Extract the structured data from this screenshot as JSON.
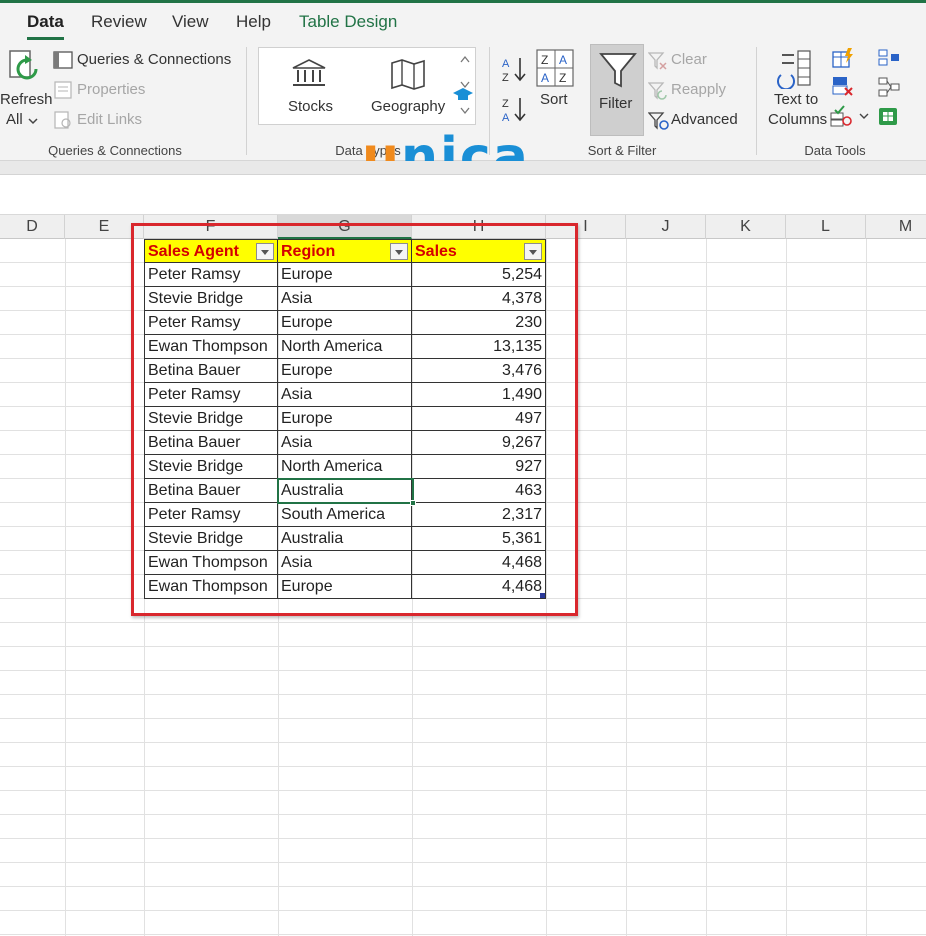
{
  "tabs": [
    {
      "label": "Data",
      "active": true
    },
    {
      "label": "Review"
    },
    {
      "label": "View"
    },
    {
      "label": "Help"
    },
    {
      "label": "Table Design"
    }
  ],
  "ribbon": {
    "queries": {
      "refresh_label_1": "Refresh",
      "refresh_label_2": "All",
      "queries_connections": "Queries & Connections",
      "properties": "Properties",
      "edit_links": "Edit Links",
      "group_label": "Queries & Connections"
    },
    "data_types": {
      "stocks": "Stocks",
      "geography": "Geography",
      "group_label": "Data Types"
    },
    "sort_filter": {
      "sort": "Sort",
      "filter": "Filter",
      "clear": "Clear",
      "reapply": "Reapply",
      "advanced": "Advanced",
      "group_label": "Sort & Filter"
    },
    "data_tools": {
      "text_to_columns_1": "Text to",
      "text_to_columns_2": "Columns",
      "group_label": "Data Tools"
    }
  },
  "watermark": {
    "first": "u",
    "rest": "nica"
  },
  "columns": [
    "D",
    "E",
    "F",
    "G",
    "H",
    "I",
    "J",
    "K",
    "L",
    "M"
  ],
  "table": {
    "headers": [
      "Sales Agent",
      "Region",
      "Sales"
    ],
    "rows": [
      [
        "Peter Ramsy",
        "Europe",
        "5,254"
      ],
      [
        "Stevie Bridge",
        "Asia",
        "4,378"
      ],
      [
        "Peter Ramsy",
        "Europe",
        "230"
      ],
      [
        "Ewan Thompson",
        "North America",
        "13,135"
      ],
      [
        "Betina Bauer",
        "Europe",
        "3,476"
      ],
      [
        "Peter Ramsy",
        "Asia",
        "1,490"
      ],
      [
        "Stevie Bridge",
        "Europe",
        "497"
      ],
      [
        "Betina Bauer",
        "Asia",
        "9,267"
      ],
      [
        "Stevie Bridge",
        "North America",
        "927"
      ],
      [
        "Betina Bauer",
        "Australia",
        "463"
      ],
      [
        "Peter Ramsy",
        "South America",
        "2,317"
      ],
      [
        "Stevie Bridge",
        "Australia",
        "5,361"
      ],
      [
        "Ewan Thompson",
        "Asia",
        "4,468"
      ],
      [
        "Ewan Thompson",
        "Europe",
        "4,468"
      ]
    ]
  },
  "colors": {
    "accent_green": "#217346",
    "header_fill": "#ffff00",
    "header_text": "#d40000",
    "highlight_box": "#d9272d"
  }
}
